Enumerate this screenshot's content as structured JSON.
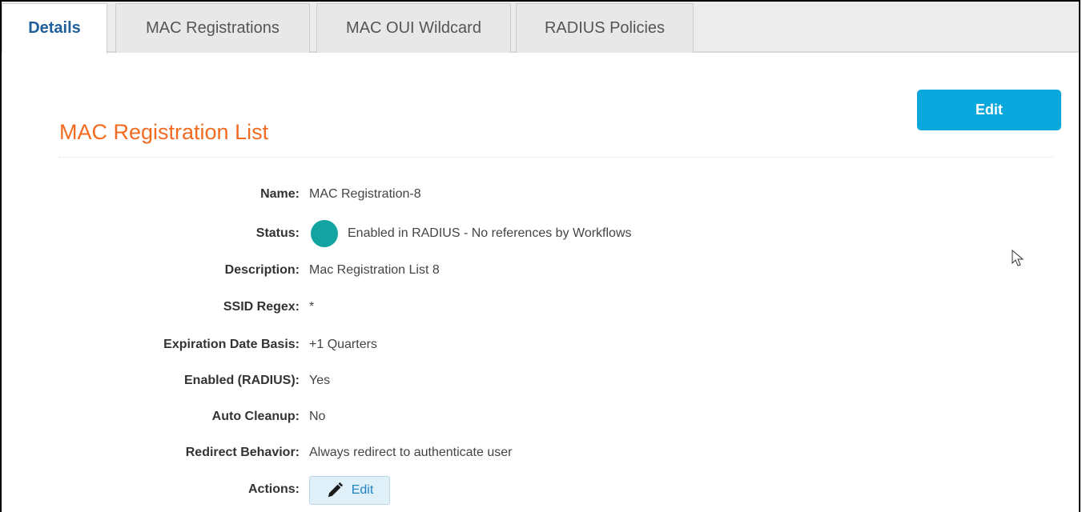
{
  "tabs": [
    {
      "label": "Details",
      "active": true
    },
    {
      "label": "MAC Registrations",
      "active": false
    },
    {
      "label": "MAC OUI Wildcard",
      "active": false
    },
    {
      "label": "RADIUS Policies",
      "active": false
    }
  ],
  "header": {
    "edit_label": "Edit",
    "title": "MAC Registration List"
  },
  "details": {
    "name": {
      "label": "Name:",
      "value": "MAC Registration-8"
    },
    "status": {
      "label": "Status:",
      "value": "Enabled in RADIUS - No references by Workflows",
      "dot_color": "#13a3a0"
    },
    "description": {
      "label": "Description:",
      "value": "Mac Registration List 8"
    },
    "ssid_regex": {
      "label": "SSID Regex:",
      "value": "*"
    },
    "expiration": {
      "label": "Expiration Date Basis:",
      "value": "+1 Quarters"
    },
    "enabled_radius": {
      "label": "Enabled (RADIUS):",
      "value": "Yes"
    },
    "auto_cleanup": {
      "label": "Auto Cleanup:",
      "value": "No"
    },
    "redirect": {
      "label": "Redirect Behavior:",
      "value": "Always redirect to authenticate user"
    },
    "actions": {
      "label": "Actions:",
      "edit_label": "Edit",
      "icon": "pencil-icon"
    }
  },
  "colors": {
    "accent": "#0aa8dc",
    "title": "#f26b21",
    "active_tab_text": "#1f5f9a"
  }
}
